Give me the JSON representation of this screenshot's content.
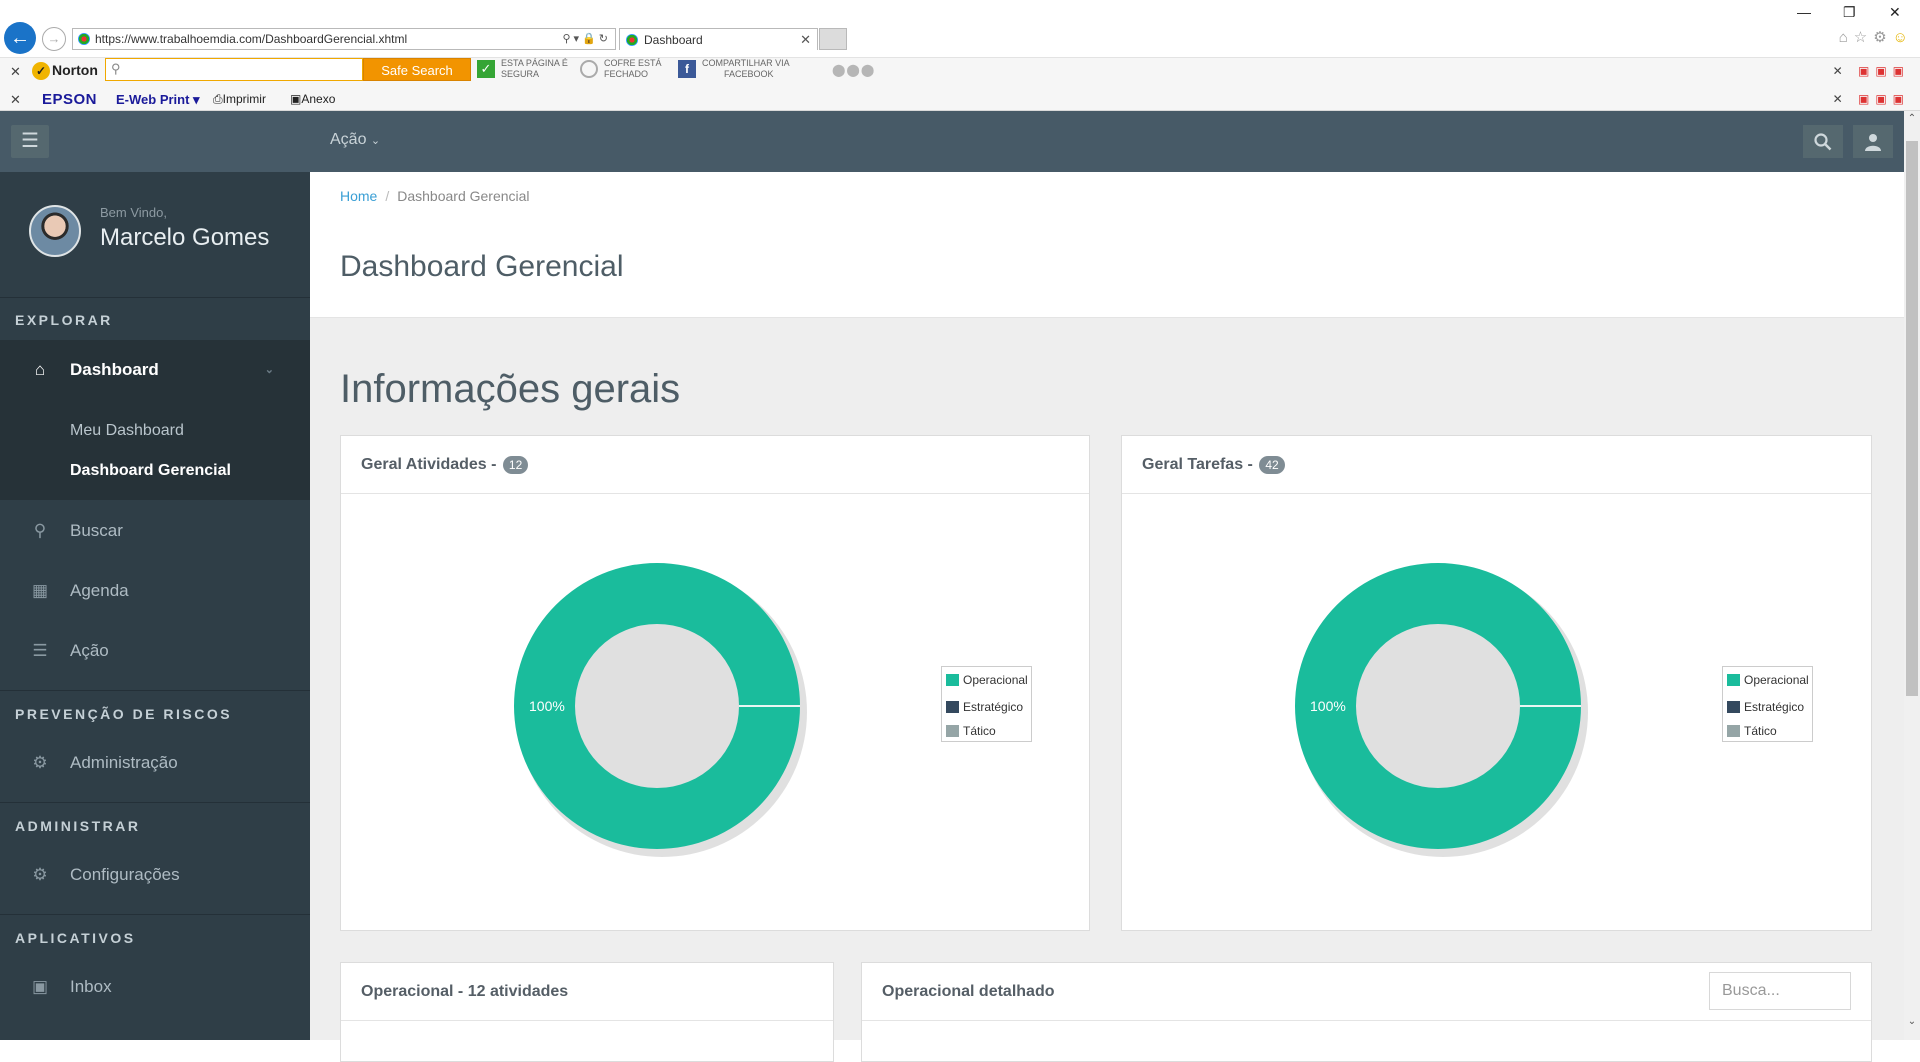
{
  "browser": {
    "url": "https://www.trabalhoemdia.com/DashboardGerencial.xhtml",
    "tab_title": "Dashboard",
    "toolbar": {
      "norton_label": "Norton",
      "safe_search_label": "Safe Search",
      "page_safe_l1": "ESTA PÁGINA É",
      "page_safe_l2": "SEGURA",
      "vault_l1": "COFRE ESTÁ",
      "vault_l2": "FECHADO",
      "share_l1": "COMPARTILHAR VIA",
      "share_l2": "FACEBOOK"
    },
    "epson_bar": {
      "brand": "EPSON",
      "ewebprint": "E-Web Print",
      "print_label": "Imprimir",
      "attach_label": "Anexo"
    }
  },
  "header": {
    "acao_menu": "Ação"
  },
  "sidebar": {
    "welcome": "Bem Vindo,",
    "user_name": "Marcelo Gomes",
    "sections": {
      "explorar": "EXPLORAR",
      "prevencao": "PREVENÇÃO DE RISCOS",
      "administrar": "ADMINISTRAR",
      "aplicativos": "APLICATIVOS"
    },
    "items": {
      "dashboard": "Dashboard",
      "meu_dashboard": "Meu Dashboard",
      "dashboard_gerencial": "Dashboard Gerencial",
      "buscar": "Buscar",
      "agenda": "Agenda",
      "acao": "Ação",
      "administracao": "Administração",
      "configuracoes": "Configurações",
      "inbox": "Inbox"
    }
  },
  "main": {
    "breadcrumb": {
      "home": "Home",
      "current": "Dashboard Gerencial"
    },
    "page_title": "Dashboard Gerencial",
    "section_heading": "Informações gerais",
    "panel_atividades": {
      "title": "Geral Atividades -",
      "count": "12"
    },
    "panel_tarefas": {
      "title": "Geral Tarefas -",
      "count": "42"
    },
    "panel_operacional": {
      "title": "Operacional - 12 atividades"
    },
    "panel_detalhado": {
      "title": "Operacional detalhado",
      "search_placeholder": "Busca..."
    }
  },
  "colors": {
    "operacional": "#1abc9c",
    "estrategico": "#34495e",
    "tatico": "#95a5a6"
  },
  "chart_data": [
    {
      "type": "pie",
      "categories": [
        "Operacional",
        "Estratégico",
        "Tático"
      ],
      "values": [
        100,
        0,
        0
      ],
      "data_labels": [
        "100%",
        "",
        ""
      ],
      "legend": "right"
    },
    {
      "type": "pie",
      "categories": [
        "Operacional",
        "Estratégico",
        "Tático"
      ],
      "values": [
        100,
        0,
        0
      ],
      "data_labels": [
        "100%",
        "",
        ""
      ],
      "legend": "right"
    }
  ]
}
